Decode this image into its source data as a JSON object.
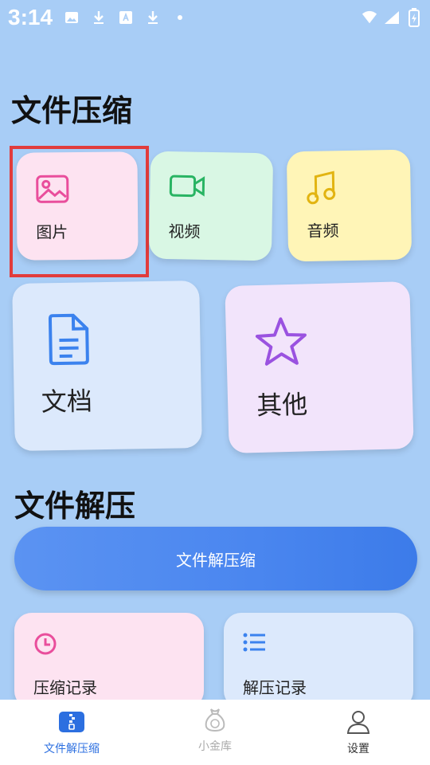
{
  "status_bar": {
    "time": "3:14"
  },
  "compress_section": {
    "title": "文件压缩",
    "items": [
      {
        "label": "图片",
        "icon": "image-icon",
        "color": "#e94e9c",
        "bg": "#fde3f1"
      },
      {
        "label": "视频",
        "icon": "video-camera-icon",
        "color": "#29b463",
        "bg": "#d9f7e4"
      },
      {
        "label": "音频",
        "icon": "music-note-icon",
        "color": "#e2b411",
        "bg": "#fff5b7"
      },
      {
        "label": "文档",
        "icon": "document-icon",
        "color": "#3b82ee",
        "bg": "#dce9fc"
      },
      {
        "label": "其他",
        "icon": "star-icon",
        "color": "#9a52e0",
        "bg": "#f2e4fb"
      }
    ]
  },
  "decompress_section": {
    "title": "文件解压",
    "button_label": "文件解压缩"
  },
  "records": [
    {
      "label": "压缩记录",
      "icon": "clock-icon",
      "color": "#e94e9c",
      "bg": "#fde3f1"
    },
    {
      "label": "解压记录",
      "icon": "list-icon",
      "color": "#3b82ee",
      "bg": "#dce9fc"
    }
  ],
  "tabbar": {
    "tabs": [
      {
        "label": "文件解压缩",
        "icon": "zip-file-icon",
        "active": true
      },
      {
        "label": "小金库",
        "icon": "money-bag-icon",
        "active": false
      },
      {
        "label": "设置",
        "icon": "user-icon",
        "active": false
      }
    ],
    "active_color": "#2c6fe0"
  }
}
